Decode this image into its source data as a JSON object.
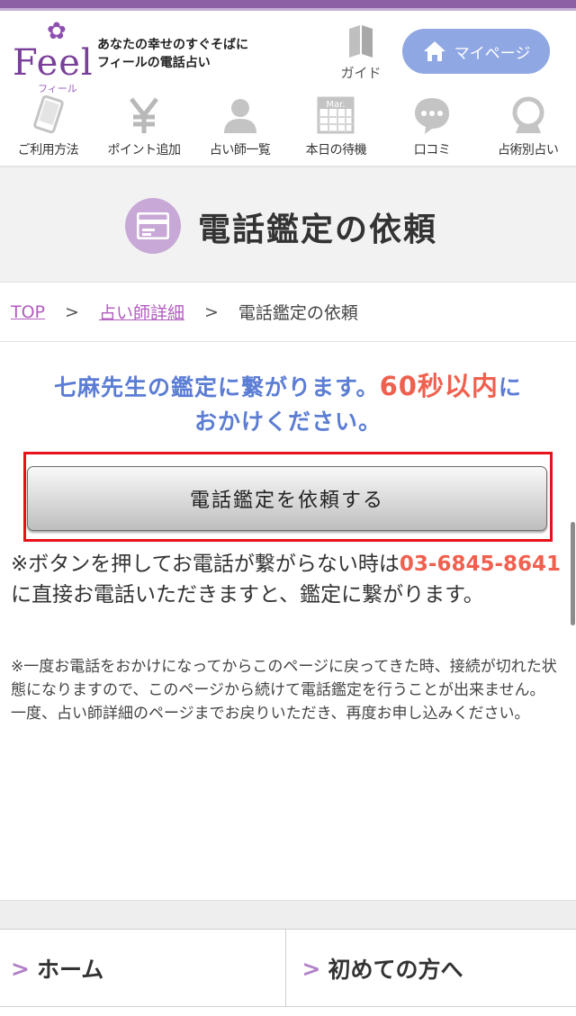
{
  "header": {
    "logo_text": "Feel",
    "logo_sub": "フィール",
    "tagline_line1": "あなたの幸せのすぐそばに",
    "tagline_line2": "フィールの電話占い",
    "guide_label": "ガイド",
    "mypage_label": "マイページ"
  },
  "nav": {
    "items": [
      {
        "label": "ご利用方法",
        "icon": "smartphone-icon"
      },
      {
        "label": "ポイント追加",
        "icon": "yen-icon"
      },
      {
        "label": "占い師一覧",
        "icon": "person-icon"
      },
      {
        "label": "本日の待機",
        "icon": "calendar-icon"
      },
      {
        "label": "口コミ",
        "icon": "chat-bubble-icon"
      },
      {
        "label": "占術別占い",
        "icon": "crystal-ball-icon"
      }
    ],
    "calendar_text": "Mar."
  },
  "page": {
    "title": "電話鑑定の依頼"
  },
  "breadcrumb": {
    "top": "TOP",
    "sep": ">",
    "fortune_teller": "占い師詳細",
    "current": "電話鑑定の依頼"
  },
  "message": {
    "part1": "七麻先生の鑑定に繋がります。",
    "highlight": "60秒以内",
    "part2": "に",
    "line2": "おかけください。"
  },
  "request_button": "電話鑑定を依頼する",
  "note1": {
    "part1": "※ボタンを押してお電話が繋がらない時は",
    "phone": "03-6845-8641",
    "part2": "に直接お電話いただきますと、鑑定に繋がります。"
  },
  "note2": {
    "line1": "※一度お電話をおかけになってからこのページに戻ってきた時、接続が切れた状態になりますので、このページから続けて電話鑑定を行うことが出来ません。",
    "line2": "一度、占い師詳細のページまでお戻りいただき、再度お申し込みください。"
  },
  "footer": {
    "arrow": ">",
    "home": "ホーム",
    "beginners": "初めての方へ"
  },
  "colors": {
    "brand_purple": "#8d5fa5",
    "message_blue": "#5b7dd4",
    "highlight_red": "#f0604f",
    "frame_red": "#e7121a",
    "mypage_blue": "#8fa7e3"
  }
}
